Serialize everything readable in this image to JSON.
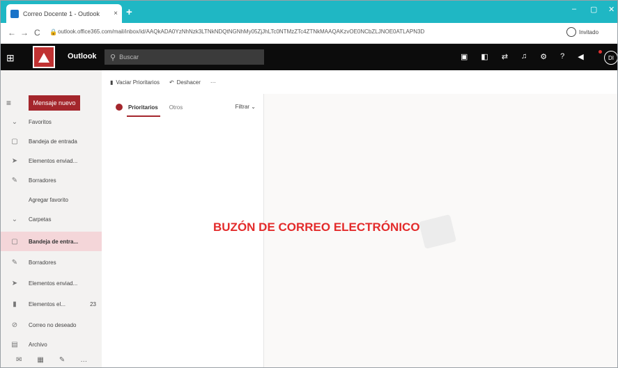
{
  "browser": {
    "tab_title": "Correo Docente 1 - Outlook",
    "tab_close": "×",
    "new_tab": "+",
    "url": "outlook.office365.com/mail/inbox/id/AAQkADA0YzNhNzk3LTNkNDQtNGNhMy05ZjJhLTc0NTMzZTc4ZTNkMAAQAKzvOE0NCbZLJNOE0ATLAPN3D",
    "profile_label": "Invitado",
    "window_controls": [
      "‒",
      "▢",
      "✕"
    ],
    "nav": [
      "←",
      "→",
      "C"
    ]
  },
  "outlook": {
    "app_title": "Outlook",
    "search_placeholder": "Buscar",
    "avatar_initials": "DI"
  },
  "sidebar": {
    "new_message": "Mensaje nuevo",
    "items": [
      {
        "label": "Favoritos",
        "icon": "chevron-down",
        "count": ""
      },
      {
        "label": "Bandeja de entrada",
        "icon": "inbox",
        "count": ""
      },
      {
        "label": "Elementos enviad...",
        "icon": "send",
        "count": ""
      },
      {
        "label": "Borradores",
        "icon": "pencil",
        "count": ""
      },
      {
        "label": "Agregar favorito",
        "icon": "",
        "count": ""
      },
      {
        "label": "Carpetas",
        "icon": "chevron-down",
        "count": ""
      },
      {
        "label": "Bandeja de entra...",
        "icon": "inbox",
        "count": ""
      },
      {
        "label": "Borradores",
        "icon": "pencil",
        "count": ""
      },
      {
        "label": "Elementos enviad...",
        "icon": "send",
        "count": ""
      },
      {
        "label": "Elementos el...",
        "icon": "trash",
        "count": "23"
      },
      {
        "label": "Correo no deseado",
        "icon": "block",
        "count": ""
      },
      {
        "label": "Archivo",
        "icon": "archive",
        "count": ""
      }
    ]
  },
  "toolbar": {
    "empty_focused": "Vaciar Prioritarios",
    "undo": "Deshacer",
    "more": "···"
  },
  "maillist": {
    "tab_focused": "Prioritarios",
    "tab_other": "Otros",
    "filter": "Filtrar"
  },
  "overlay_caption": "BUZÓN DE CORREO ELECTRÓNICO",
  "colors": {
    "tab_strip": "#1fb7c4",
    "header": "#0c0c0c",
    "accent": "#a4262c",
    "caption": "#e32b2b"
  }
}
